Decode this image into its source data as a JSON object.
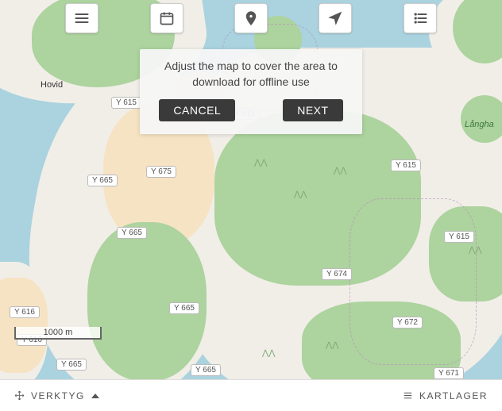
{
  "dialog": {
    "message": "Adjust the map to cover the area to download for offline use",
    "cancel": "CANCEL",
    "next": "NEXT"
  },
  "bottombar": {
    "tools": "VERKTYG",
    "layers": "KARTLAGER"
  },
  "scale": {
    "label": "1000 m"
  },
  "places": {
    "hovid": "Hovid",
    "langharen": "Långha"
  },
  "roads": {
    "y615a": "Y 615",
    "y615b": "Y 615",
    "y615c": "Y 615",
    "y615d": "Y 615",
    "y665a": "Y 665",
    "y665b": "Y 665",
    "y665c": "Y 665",
    "y665d": "Y 665",
    "y665e": "Y 665",
    "y675": "Y 675",
    "y674": "Y 674",
    "y672": "Y 672",
    "y671": "Y 671",
    "y616a": "Y 616",
    "y616b": "Y 616"
  },
  "icons": {
    "menu": "menu-icon",
    "calendar": "calendar-icon",
    "pin": "pin-icon",
    "locate": "locate-icon",
    "list": "list-icon",
    "move": "move-icon",
    "layerlist": "layer-list-icon"
  }
}
